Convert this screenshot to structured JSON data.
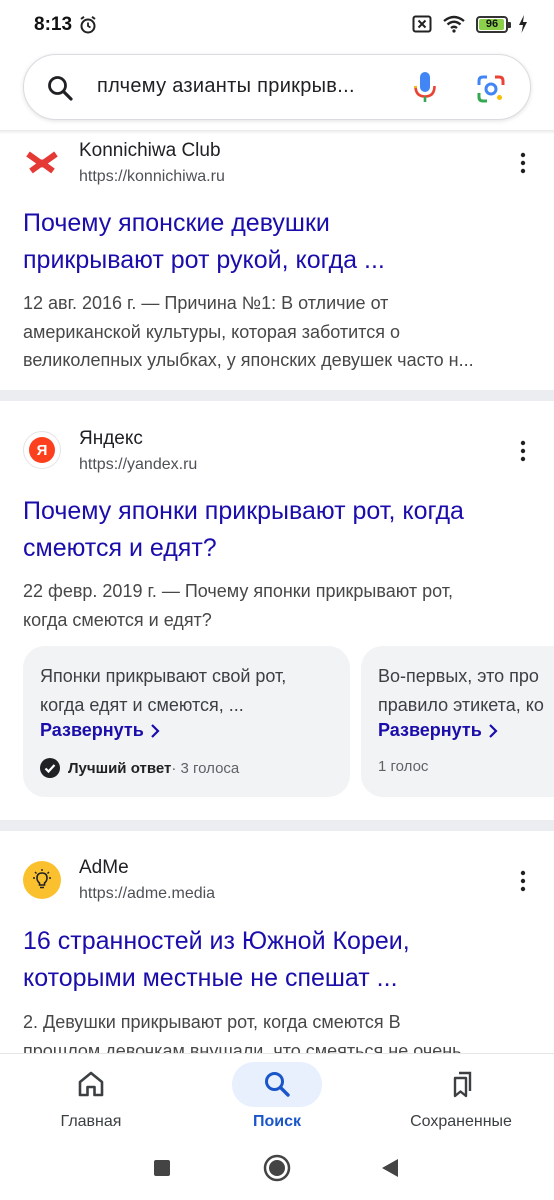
{
  "status_bar": {
    "time": "8:13",
    "battery": "96",
    "battery_level": 0.96,
    "icons": [
      "alarm-icon",
      "sim-blocked-icon",
      "wifi-icon",
      "battery-icon",
      "charging-icon"
    ]
  },
  "search": {
    "query": "плчему азианты прикрыв..."
  },
  "results": [
    {
      "site_name": "Konnichiwa Club",
      "site_url": "https://konnichiwa.ru",
      "title_lines": [
        "Почему японские девушки",
        "прикрывают рот рукой, когда ..."
      ],
      "snippet_lines": [
        "12 авг. 2016 г. — Причина №1: В отличие от",
        "американской культуры, которая заботится о",
        "великолепных улыбках, у японских девушек часто н..."
      ]
    },
    {
      "site_name": "Яндекс",
      "site_url": "https://yandex.ru",
      "logo_letter": "Я",
      "title_lines": [
        "Почему японки прикрывают рот, когда",
        "смеются и едят?"
      ],
      "snippet_lines": [
        "22 февр. 2019 г. — Почему японки прикрывают рот,",
        "когда смеются и едят?"
      ],
      "answers": [
        {
          "text_lines": [
            "Японки прикрывают свой рот,",
            "когда едят и смеются, ..."
          ],
          "expand": "Развернуть",
          "best": "Лучший ответ",
          "votes": " · 3 голоса"
        },
        {
          "text_lines": [
            "Во-первых, это про",
            "правило этикета, ко"
          ],
          "expand": "Развернуть",
          "votes": "1 голос"
        }
      ]
    },
    {
      "site_name": "AdMe",
      "site_url": "https://adme.media",
      "title_lines": [
        "16 странностей из Южной Кореи,",
        "которыми местные не спешат ..."
      ],
      "snippet_lines": [
        "2. Девушки прикрывают рот, когда смеются В",
        "прошлом девочкам внушали, что смеяться не очень"
      ]
    }
  ],
  "bottom_nav": {
    "items": [
      {
        "label": "Главная",
        "icon": "home-icon"
      },
      {
        "label": "Поиск",
        "icon": "search-icon",
        "active": true
      },
      {
        "label": "Сохраненные",
        "icon": "saved-icon"
      }
    ]
  },
  "colors": {
    "link": "#1a0dab",
    "accent": "#1a56c9",
    "divider": "#ebedf0"
  }
}
